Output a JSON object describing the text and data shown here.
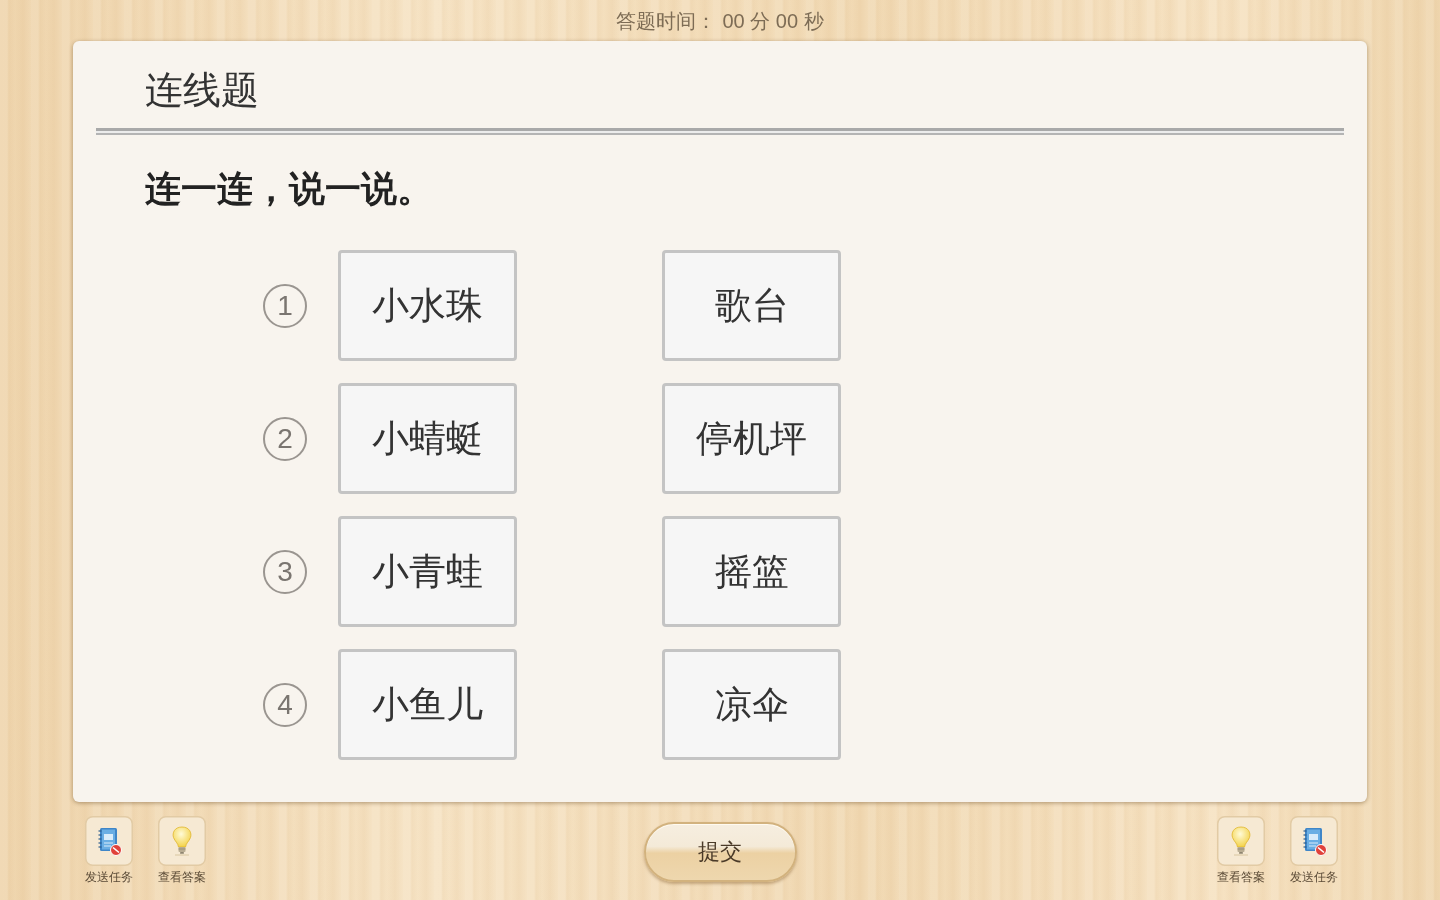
{
  "timer": {
    "label": "答题时间：",
    "value": "00 分 00 秒"
  },
  "question": {
    "title": "连线题",
    "instruction": "连一连，说一说。"
  },
  "pairs": [
    {
      "number": "1",
      "left": "小水珠",
      "right": "歌台"
    },
    {
      "number": "2",
      "left": "小蜻蜓",
      "right": "停机坪"
    },
    {
      "number": "3",
      "left": "小青蛙",
      "right": "摇篮"
    },
    {
      "number": "4",
      "left": "小鱼儿",
      "right": "凉伞"
    }
  ],
  "toolbar_left": [
    {
      "kind": "task",
      "label": "发送任务"
    },
    {
      "kind": "answer",
      "label": "查看答案"
    }
  ],
  "submit_button": {
    "label": "提交"
  },
  "toolbar_right": [
    {
      "kind": "answer",
      "label": "查看答案"
    },
    {
      "kind": "task",
      "label": "发送任务"
    }
  ]
}
